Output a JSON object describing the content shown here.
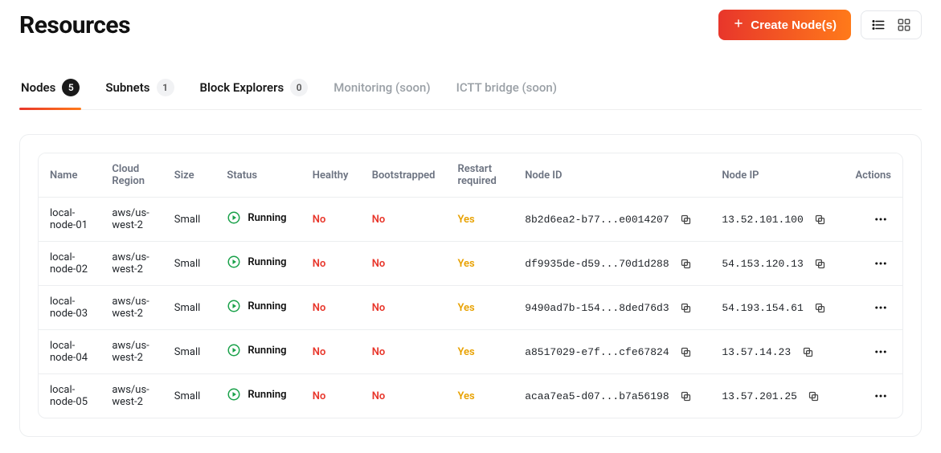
{
  "header": {
    "title": "Resources",
    "create_label": "Create Node(s)"
  },
  "tabs": [
    {
      "label": "Nodes",
      "count": "5",
      "active": true
    },
    {
      "label": "Subnets",
      "count": "1",
      "active": false
    },
    {
      "label": "Block Explorers",
      "count": "0",
      "active": false
    },
    {
      "label": "Monitoring (soon)",
      "disabled": true
    },
    {
      "label": "ICTT bridge (soon)",
      "disabled": true
    }
  ],
  "columns": {
    "name": "Name",
    "region": "Cloud Region",
    "size": "Size",
    "status": "Status",
    "healthy": "Healthy",
    "bootstrapped": "Bootstrapped",
    "restart": "Restart required",
    "node_id": "Node ID",
    "node_ip": "Node IP",
    "actions": "Actions"
  },
  "rows": [
    {
      "name": "local-node-01",
      "region": "aws/us-west-2",
      "size": "Small",
      "status": "Running",
      "healthy": "No",
      "bootstrapped": "No",
      "restart": "Yes",
      "node_id": "8b2d6ea2-b77...e0014207",
      "node_ip": "13.52.101.100"
    },
    {
      "name": "local-node-02",
      "region": "aws/us-west-2",
      "size": "Small",
      "status": "Running",
      "healthy": "No",
      "bootstrapped": "No",
      "restart": "Yes",
      "node_id": "df9935de-d59...70d1d288",
      "node_ip": "54.153.120.13"
    },
    {
      "name": "local-node-03",
      "region": "aws/us-west-2",
      "size": "Small",
      "status": "Running",
      "healthy": "No",
      "bootstrapped": "No",
      "restart": "Yes",
      "node_id": "9490ad7b-154...8ded76d3",
      "node_ip": "54.193.154.61"
    },
    {
      "name": "local-node-04",
      "region": "aws/us-west-2",
      "size": "Small",
      "status": "Running",
      "healthy": "No",
      "bootstrapped": "No",
      "restart": "Yes",
      "node_id": "a8517029-e7f...cfe67824",
      "node_ip": "13.57.14.23"
    },
    {
      "name": "local-node-05",
      "region": "aws/us-west-2",
      "size": "Small",
      "status": "Running",
      "healthy": "No",
      "bootstrapped": "No",
      "restart": "Yes",
      "node_id": "acaa7ea5-d07...b7a56198",
      "node_ip": "13.57.201.25"
    }
  ]
}
